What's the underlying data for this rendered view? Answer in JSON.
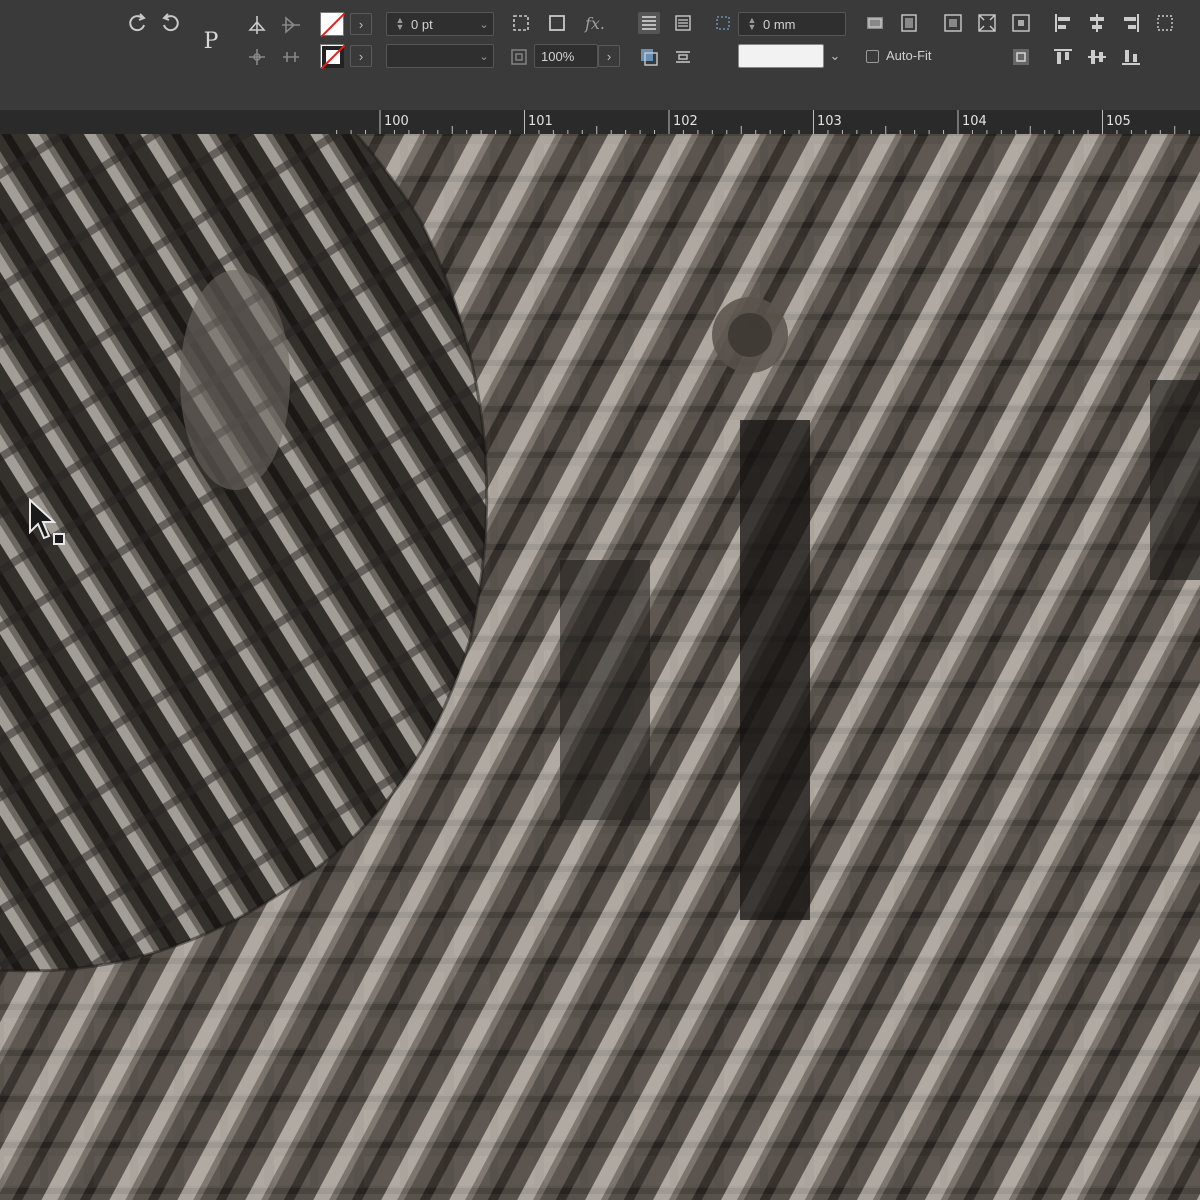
{
  "app": "InDesign-style editor",
  "control_bar": {
    "stroke_weight": "0 pt",
    "scale": "100%",
    "offset": "0 mm",
    "auto_fit_label": "Auto-Fit",
    "auto_fit_checked": false,
    "paragraph_icon": "P",
    "fx_icon": "fx."
  },
  "ruler": {
    "labels": [
      "100",
      "101",
      "102",
      "103",
      "104",
      "105"
    ]
  },
  "colors": {
    "toolbar_bg": "#3a3a3a",
    "ruler_bg": "#2a2a2a",
    "photo_tone": "#6b625a"
  },
  "canvas": {
    "content": "black-and-white building facade photo, zoomed in, with a pixelated enlarged copy in upper-left"
  }
}
